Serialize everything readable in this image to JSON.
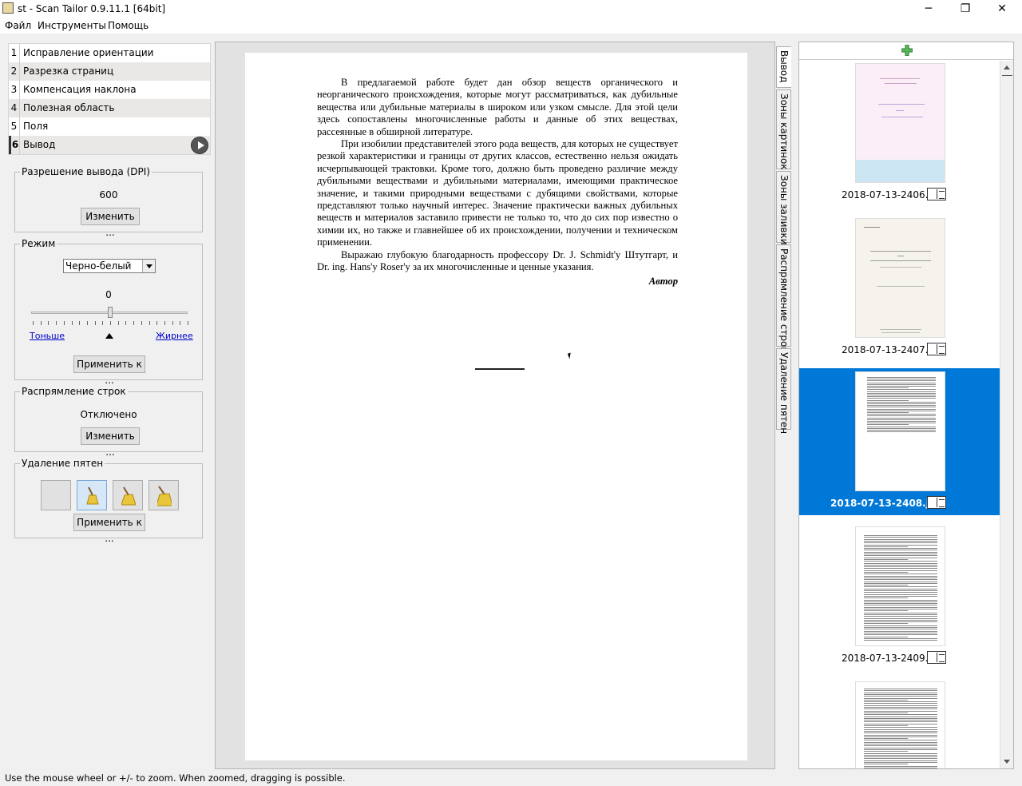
{
  "window": {
    "title": "st - Scan Tailor 0.9.11.1 [64bit]",
    "minimize": "─",
    "restore": "❐",
    "close": "✕"
  },
  "menu": [
    "Файл",
    "Инструменты",
    "Помощь"
  ],
  "stages": [
    {
      "num": "1",
      "label": "Исправление ориентации"
    },
    {
      "num": "2",
      "label": "Разрезка страниц"
    },
    {
      "num": "3",
      "label": "Компенсация наклона"
    },
    {
      "num": "4",
      "label": "Полезная область"
    },
    {
      "num": "5",
      "label": "Поля"
    },
    {
      "num": "6",
      "label": "Вывод"
    }
  ],
  "output_dpi": {
    "title": "Разрешение вывода (DPI)",
    "value": "600",
    "change_label": "Изменить ..."
  },
  "mode": {
    "title": "Режим",
    "selected": "Черно-белый",
    "threshold": "0",
    "thinner": "Тоньше",
    "thicker": "Жирнее",
    "apply_label": "Применить к ..."
  },
  "dewarp": {
    "title": "Распрямление строк",
    "status": "Отключено",
    "change_label": "Изменить ..."
  },
  "despeckle": {
    "title": "Удаление пятен",
    "apply_label": "Применить к ..."
  },
  "page_text": {
    "p1": "В предлагаемой работе будет дан обзор веществ органического и неорганического происхождения, которые могут рассматриваться, как дубильные вещества или дубильные материалы в широком или узком смысле. Для этой цели здесь сопоставлены многочисленные работы и данные об этих веществах, рассеянные в обширной литературе.",
    "p2": "При изобилии представителей этого рода веществ, для которых не существует резкой характеристики и границы от других классов, естественно нельзя ожидать исчерпывающей трактовки. Кроме того, должно быть проведено различие между дубильными веществами и дубильными материалами, имеющими практическое значение, и такими природными веществами с дубящими свойствами, которые представляют только научный интерес. Значение практически важных дубильных веществ и материалов заставило привести не только то, что до сих пор известно о химии их, но также и главнейшее об их происхождении, получении и техническом применении.",
    "p3": "Выражаю глубокую благодарность профессору Dr. J. Schmidt'y Штутгарт, и Dr. ing. Hans'y Roser'y за их многочисленные и ценные указания.",
    "author": "Автор"
  },
  "tabs": [
    "Вывод",
    "Зоны картинок",
    "Зоны заливки",
    "Распрямление строк",
    "Удаление пятен"
  ],
  "thumbnails": [
    {
      "name": "2018-07-13-2406.jpg"
    },
    {
      "name": "2018-07-13-2407.jpg"
    },
    {
      "name": "2018-07-13-2408.jpg"
    },
    {
      "name": "2018-07-13-2409.jpg"
    },
    {
      "name": ""
    }
  ],
  "status": "Use the mouse wheel or +/- to zoom.  When zoomed, dragging is possible.",
  "colors": {
    "selection": "#0078d7",
    "link": "#0000cc"
  }
}
